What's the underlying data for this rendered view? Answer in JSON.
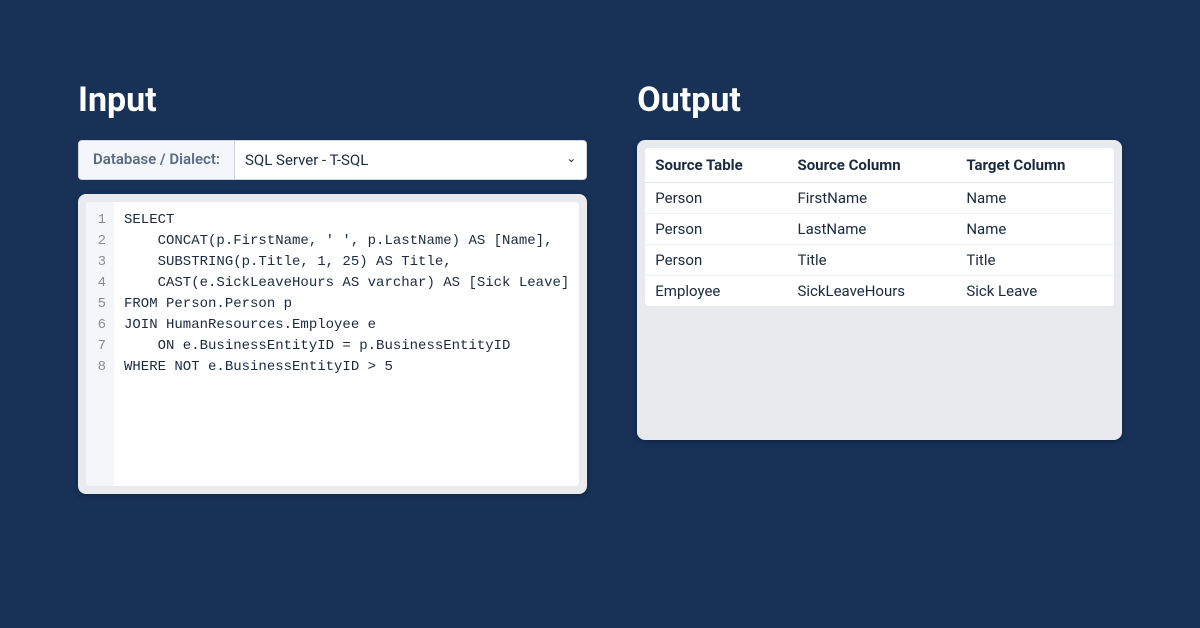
{
  "input": {
    "heading": "Input",
    "dialect_label": "Database / Dialect:",
    "dialect_value": "SQL Server - T-SQL",
    "code_lines": [
      "SELECT",
      "    CONCAT(p.FirstName, ' ', p.LastName) AS [Name],",
      "    SUBSTRING(p.Title, 1, 25) AS Title,",
      "    CAST(e.SickLeaveHours AS varchar) AS [Sick Leave]",
      "FROM Person.Person p",
      "JOIN HumanResources.Employee e",
      "    ON e.BusinessEntityID = p.BusinessEntityID",
      "WHERE NOT e.BusinessEntityID > 5"
    ]
  },
  "output": {
    "heading": "Output",
    "headers": [
      "Source Table",
      "Source Column",
      "Target Column"
    ],
    "rows": [
      {
        "source_table": "Person",
        "source_column": "FirstName",
        "target_column": "Name"
      },
      {
        "source_table": "Person",
        "source_column": "LastName",
        "target_column": "Name"
      },
      {
        "source_table": "Person",
        "source_column": "Title",
        "target_column": "Title"
      },
      {
        "source_table": "Employee",
        "source_column": "SickLeaveHours",
        "target_column": "Sick Leave"
      }
    ]
  }
}
